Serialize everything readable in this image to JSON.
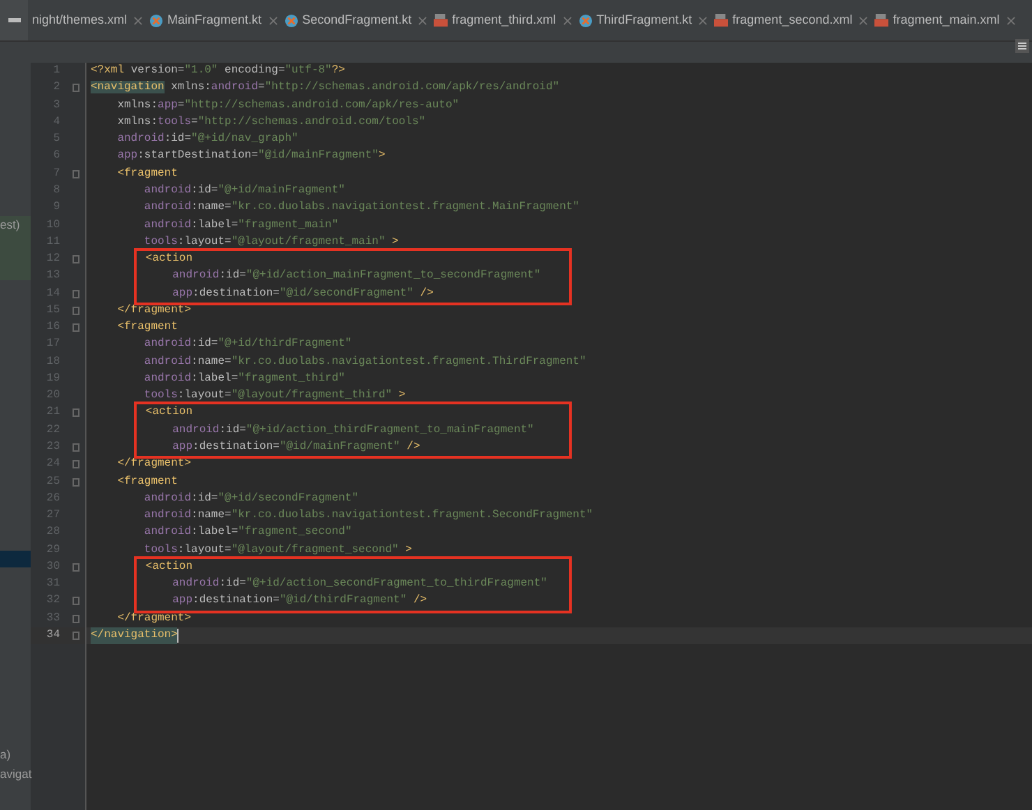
{
  "tabs": [
    {
      "label": "night/themes.xml",
      "kind": "plain",
      "selected": false
    },
    {
      "label": "MainFragment.kt",
      "kind": "kotlin",
      "selected": false
    },
    {
      "label": "SecondFragment.kt",
      "kind": "kotlin",
      "selected": false
    },
    {
      "label": "fragment_third.xml",
      "kind": "xml",
      "selected": false
    },
    {
      "label": "ThirdFragment.kt",
      "kind": "kotlin",
      "selected": false
    },
    {
      "label": "fragment_second.xml",
      "kind": "xml",
      "selected": false
    },
    {
      "label": "fragment_main.xml",
      "kind": "xml",
      "selected": false
    }
  ],
  "sidebar": {
    "fragments": [
      {
        "text": "est)",
        "selected": true
      },
      {
        "text": "a)",
        "selected": false
      },
      {
        "text": "avigat",
        "selected": false
      }
    ]
  },
  "editor": {
    "lines": [
      {
        "number": "1",
        "fold": false,
        "boxed": false,
        "current": false,
        "tokens": [
          {
            "kind": "tag",
            "text": "<?xml "
          },
          {
            "kind": "attr",
            "text": "version="
          },
          {
            "kind": "str",
            "text": "\"1.0\" "
          },
          {
            "kind": "attr",
            "text": "encoding="
          },
          {
            "kind": "str",
            "text": "\"utf-8\""
          },
          {
            "kind": "tag",
            "text": "?>"
          }
        ]
      },
      {
        "number": "2",
        "fold": true,
        "boxed": false,
        "current": false,
        "tokens": [
          {
            "kind": "match",
            "text": "<navigation"
          },
          {
            "kind": "attr",
            "text": " xmlns:"
          },
          {
            "kind": "ns",
            "text": "android"
          },
          {
            "kind": "attr",
            "text": "="
          },
          {
            "kind": "str",
            "text": "\"http://schemas.android.com/apk/res/android\""
          }
        ]
      },
      {
        "number": "3",
        "fold": false,
        "boxed": false,
        "current": false,
        "tokens": [
          {
            "kind": "attr",
            "text": "    xmlns:"
          },
          {
            "kind": "ns",
            "text": "app"
          },
          {
            "kind": "attr",
            "text": "="
          },
          {
            "kind": "str",
            "text": "\"http://schemas.android.com/apk/res-auto\""
          }
        ]
      },
      {
        "number": "4",
        "fold": false,
        "boxed": false,
        "current": false,
        "tokens": [
          {
            "kind": "attr",
            "text": "    xmlns:"
          },
          {
            "kind": "ns",
            "text": "tools"
          },
          {
            "kind": "attr",
            "text": "="
          },
          {
            "kind": "str",
            "text": "\"http://schemas.android.com/tools\""
          }
        ]
      },
      {
        "number": "5",
        "fold": false,
        "boxed": false,
        "current": false,
        "tokens": [
          {
            "kind": "ns",
            "text": "    android"
          },
          {
            "kind": "attr",
            "text": ":id="
          },
          {
            "kind": "str",
            "text": "\"@+id/nav_graph\""
          }
        ]
      },
      {
        "number": "6",
        "fold": false,
        "boxed": false,
        "current": false,
        "tokens": [
          {
            "kind": "ns",
            "text": "    app"
          },
          {
            "kind": "attr",
            "text": ":startDestination="
          },
          {
            "kind": "str",
            "text": "\"@id/mainFragment\""
          },
          {
            "kind": "tag",
            "text": ">"
          }
        ]
      },
      {
        "number": "7",
        "fold": true,
        "boxed": false,
        "current": false,
        "tokens": [
          {
            "kind": "tag",
            "text": "    <fragment"
          }
        ]
      },
      {
        "number": "8",
        "fold": false,
        "boxed": false,
        "current": false,
        "tokens": [
          {
            "kind": "ns",
            "text": "        android"
          },
          {
            "kind": "attr",
            "text": ":id="
          },
          {
            "kind": "str",
            "text": "\"@+id/mainFragment\""
          }
        ]
      },
      {
        "number": "9",
        "fold": false,
        "boxed": false,
        "current": false,
        "tokens": [
          {
            "kind": "ns",
            "text": "        android"
          },
          {
            "kind": "attr",
            "text": ":name="
          },
          {
            "kind": "str",
            "text": "\"kr.co.duolabs.navigationtest.fragment.MainFragment\""
          }
        ]
      },
      {
        "number": "10",
        "fold": false,
        "boxed": false,
        "current": false,
        "tokens": [
          {
            "kind": "ns",
            "text": "        android"
          },
          {
            "kind": "attr",
            "text": ":label="
          },
          {
            "kind": "str",
            "text": "\"fragment_main\""
          }
        ]
      },
      {
        "number": "11",
        "fold": false,
        "boxed": false,
        "current": false,
        "tokens": [
          {
            "kind": "ns",
            "text": "        tools"
          },
          {
            "kind": "attr",
            "text": ":layout="
          },
          {
            "kind": "str",
            "text": "\"@layout/fragment_main\" "
          },
          {
            "kind": "tag",
            "text": ">"
          }
        ]
      },
      {
        "number": "12",
        "fold": true,
        "boxed": true,
        "current": false,
        "tokens": [
          {
            "kind": "tag",
            "text": "        <action"
          }
        ]
      },
      {
        "number": "13",
        "fold": false,
        "boxed": true,
        "current": false,
        "tokens": [
          {
            "kind": "ns",
            "text": "            android"
          },
          {
            "kind": "attr",
            "text": ":id="
          },
          {
            "kind": "str",
            "text": "\"@+id/action_mainFragment_to_secondFragment\""
          }
        ]
      },
      {
        "number": "14",
        "fold": true,
        "boxed": true,
        "current": false,
        "tokens": [
          {
            "kind": "ns",
            "text": "            app"
          },
          {
            "kind": "attr",
            "text": ":destination="
          },
          {
            "kind": "str",
            "text": "\"@id/secondFragment\" "
          },
          {
            "kind": "tag",
            "text": "/>"
          }
        ]
      },
      {
        "number": "15",
        "fold": true,
        "boxed": false,
        "current": false,
        "tokens": [
          {
            "kind": "tag",
            "text": "    </fragment>"
          }
        ]
      },
      {
        "number": "16",
        "fold": true,
        "boxed": false,
        "current": false,
        "tokens": [
          {
            "kind": "tag",
            "text": "    <fragment"
          }
        ]
      },
      {
        "number": "17",
        "fold": false,
        "boxed": false,
        "current": false,
        "tokens": [
          {
            "kind": "ns",
            "text": "        android"
          },
          {
            "kind": "attr",
            "text": ":id="
          },
          {
            "kind": "str",
            "text": "\"@+id/thirdFragment\""
          }
        ]
      },
      {
        "number": "18",
        "fold": false,
        "boxed": false,
        "current": false,
        "tokens": [
          {
            "kind": "ns",
            "text": "        android"
          },
          {
            "kind": "attr",
            "text": ":name="
          },
          {
            "kind": "str",
            "text": "\"kr.co.duolabs.navigationtest.fragment.ThirdFragment\""
          }
        ]
      },
      {
        "number": "19",
        "fold": false,
        "boxed": false,
        "current": false,
        "tokens": [
          {
            "kind": "ns",
            "text": "        android"
          },
          {
            "kind": "attr",
            "text": ":label="
          },
          {
            "kind": "str",
            "text": "\"fragment_third\""
          }
        ]
      },
      {
        "number": "20",
        "fold": false,
        "boxed": false,
        "current": false,
        "tokens": [
          {
            "kind": "ns",
            "text": "        tools"
          },
          {
            "kind": "attr",
            "text": ":layout="
          },
          {
            "kind": "str",
            "text": "\"@layout/fragment_third\" "
          },
          {
            "kind": "tag",
            "text": ">"
          }
        ]
      },
      {
        "number": "21",
        "fold": true,
        "boxed": true,
        "current": false,
        "tokens": [
          {
            "kind": "tag",
            "text": "        <action"
          }
        ]
      },
      {
        "number": "22",
        "fold": false,
        "boxed": true,
        "current": false,
        "tokens": [
          {
            "kind": "ns",
            "text": "            android"
          },
          {
            "kind": "attr",
            "text": ":id="
          },
          {
            "kind": "str",
            "text": "\"@+id/action_thirdFragment_to_mainFragment\""
          }
        ]
      },
      {
        "number": "23",
        "fold": true,
        "boxed": true,
        "current": false,
        "tokens": [
          {
            "kind": "ns",
            "text": "            app"
          },
          {
            "kind": "attr",
            "text": ":destination="
          },
          {
            "kind": "str",
            "text": "\"@id/mainFragment\" "
          },
          {
            "kind": "tag",
            "text": "/>"
          }
        ]
      },
      {
        "number": "24",
        "fold": true,
        "boxed": false,
        "current": false,
        "tokens": [
          {
            "kind": "tag",
            "text": "    </fragment>"
          }
        ]
      },
      {
        "number": "25",
        "fold": true,
        "boxed": false,
        "current": false,
        "tokens": [
          {
            "kind": "tag",
            "text": "    <fragment"
          }
        ]
      },
      {
        "number": "26",
        "fold": false,
        "boxed": false,
        "current": false,
        "tokens": [
          {
            "kind": "ns",
            "text": "        android"
          },
          {
            "kind": "attr",
            "text": ":id="
          },
          {
            "kind": "str",
            "text": "\"@+id/secondFragment\""
          }
        ]
      },
      {
        "number": "27",
        "fold": false,
        "boxed": false,
        "current": false,
        "tokens": [
          {
            "kind": "ns",
            "text": "        android"
          },
          {
            "kind": "attr",
            "text": ":name="
          },
          {
            "kind": "str",
            "text": "\"kr.co.duolabs.navigationtest.fragment.SecondFragment\""
          }
        ]
      },
      {
        "number": "28",
        "fold": false,
        "boxed": false,
        "current": false,
        "tokens": [
          {
            "kind": "ns",
            "text": "        android"
          },
          {
            "kind": "attr",
            "text": ":label="
          },
          {
            "kind": "str",
            "text": "\"fragment_second\""
          }
        ]
      },
      {
        "number": "29",
        "fold": false,
        "boxed": false,
        "current": false,
        "tokens": [
          {
            "kind": "ns",
            "text": "        tools"
          },
          {
            "kind": "attr",
            "text": ":layout="
          },
          {
            "kind": "str",
            "text": "\"@layout/fragment_second\" "
          },
          {
            "kind": "tag",
            "text": ">"
          }
        ]
      },
      {
        "number": "30",
        "fold": true,
        "boxed": true,
        "current": false,
        "tokens": [
          {
            "kind": "tag",
            "text": "        <action"
          }
        ]
      },
      {
        "number": "31",
        "fold": false,
        "boxed": true,
        "current": false,
        "tokens": [
          {
            "kind": "ns",
            "text": "            android"
          },
          {
            "kind": "attr",
            "text": ":id="
          },
          {
            "kind": "str",
            "text": "\"@+id/action_secondFragment_to_thirdFragment\""
          }
        ]
      },
      {
        "number": "32",
        "fold": true,
        "boxed": true,
        "current": false,
        "tokens": [
          {
            "kind": "ns",
            "text": "            app"
          },
          {
            "kind": "attr",
            "text": ":destination="
          },
          {
            "kind": "str",
            "text": "\"@id/thirdFragment\" "
          },
          {
            "kind": "tag",
            "text": "/>"
          }
        ]
      },
      {
        "number": "33",
        "fold": true,
        "boxed": false,
        "current": false,
        "tokens": [
          {
            "kind": "tag",
            "text": "    </fragment>"
          }
        ]
      },
      {
        "number": "34",
        "fold": true,
        "boxed": false,
        "current": true,
        "tokens": [
          {
            "kind": "match",
            "text": "</navigation>"
          }
        ]
      }
    ]
  }
}
